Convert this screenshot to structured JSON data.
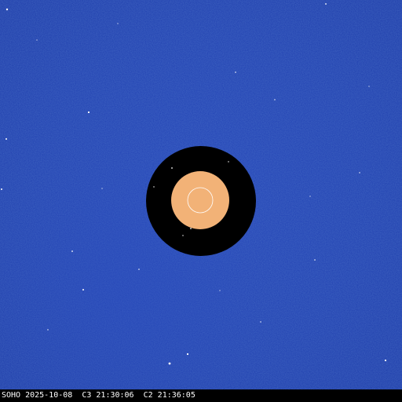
{
  "image": {
    "caption": "SOHO 2025-10-08  C3 21:30:06  C2 21:36:05"
  },
  "colors": {
    "background_field": "#1f3fb0",
    "background_field_dark": "#1836a0",
    "occulter_disk": "#000000",
    "inner_occulter_c2": "#f2b277",
    "sun_outline": "#ffffff",
    "stars": "#ffffff",
    "caption_text": "#ffffff"
  }
}
